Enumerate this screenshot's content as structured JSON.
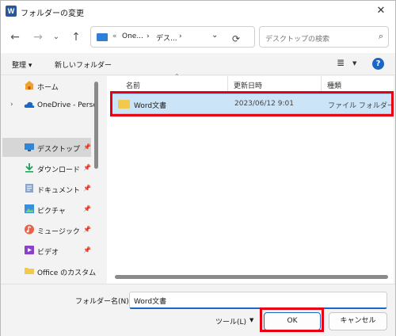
{
  "window": {
    "title": "フォルダーの変更",
    "app_icon": "W"
  },
  "address": {
    "crumbs": [
      "«",
      "One...",
      "›",
      "デス...",
      "›"
    ]
  },
  "search": {
    "placeholder": "デスクトップの検索"
  },
  "toolbar": {
    "organize": "整理 ▾",
    "new_folder": "新しいフォルダー"
  },
  "sidebar": {
    "items": [
      {
        "label": "ホーム",
        "icon": "home-icon"
      },
      {
        "label": "OneDrive - Perso",
        "icon": "cloud-icon"
      },
      {
        "label": "デスクトップ",
        "icon": "desktop-icon",
        "selected": true
      },
      {
        "label": "ダウンロード",
        "icon": "download-icon"
      },
      {
        "label": "ドキュメント",
        "icon": "document-icon"
      },
      {
        "label": "ピクチャ",
        "icon": "pictures-icon"
      },
      {
        "label": "ミュージック",
        "icon": "music-icon"
      },
      {
        "label": "ビデオ",
        "icon": "video-icon"
      },
      {
        "label": "Office のカスタム テ",
        "icon": "folder-icon"
      }
    ]
  },
  "columns": {
    "name": "名前",
    "modified": "更新日時",
    "type": "種類"
  },
  "files": [
    {
      "name": "Word文書",
      "modified": "2023/06/12 9:01",
      "type": "ファイル フォルダー"
    }
  ],
  "footer": {
    "folder_name_label": "フォルダー名(N):",
    "folder_name_value": "Word文書",
    "tools_label": "ツール(L)",
    "ok_label": "OK",
    "cancel_label": "キャンセル"
  },
  "colors": {
    "accent": "#1a67c5",
    "highlight": "#e60012",
    "selection": "#cce4f7"
  }
}
